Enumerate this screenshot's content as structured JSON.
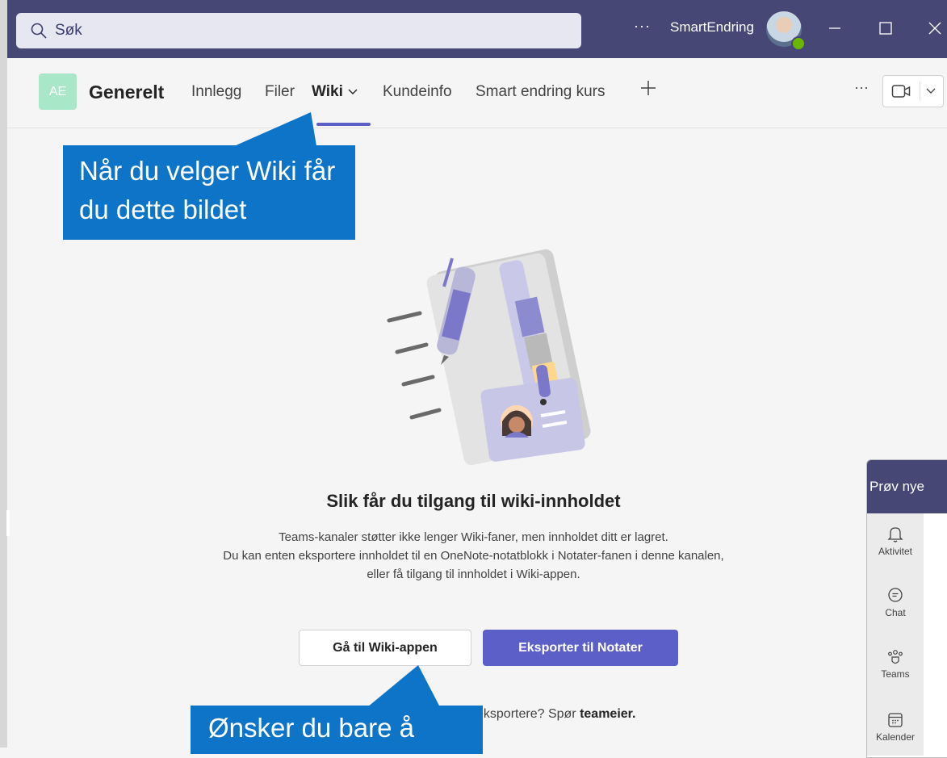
{
  "titlebar": {
    "search_placeholder": "Søk",
    "more": "···",
    "org_name": "SmartEndring"
  },
  "channel": {
    "team_initials": "AE",
    "name": "Generelt",
    "tabs": [
      {
        "label": "Innlegg"
      },
      {
        "label": "Filer"
      },
      {
        "label": "Wiki"
      },
      {
        "label": "Kundeinfo"
      },
      {
        "label": "Smart endring kurs"
      }
    ],
    "more": "···"
  },
  "callouts": {
    "wiki_hint": "Når du velger Wiki får du dette bildet",
    "export_hint": "Ønsker du bare å"
  },
  "main": {
    "heading": "Slik får du tilgang til wiki-innholdet",
    "body_lines": [
      "Teams-kanaler støtter ikke lenger Wiki-faner, men innholdet ditt er lagret.",
      "Du kan enten eksportere innholdet til en OneNote-notatblokk i Notater-fanen i denne kanalen,",
      "eller få tilgang til innholdet i Wiki-appen."
    ],
    "btn_wiki_app": "Gå til Wiki-appen",
    "btn_export": "Eksporter til Notater",
    "footer_prefix": "eksportere? Spør ",
    "footer_bold": "teameier."
  },
  "mini_panel": {
    "header": "Prøv nye",
    "rail": [
      {
        "label": "Aktivitet",
        "icon": "bell-icon"
      },
      {
        "label": "Chat",
        "icon": "chat-icon"
      },
      {
        "label": "Teams",
        "icon": "teams-icon"
      },
      {
        "label": "Kalender",
        "icon": "calendar-icon"
      }
    ]
  },
  "colors": {
    "titlebar": "#464775",
    "accent": "#5b5fc7",
    "callout": "#0e74c7",
    "team_avatar": "#a9e7c9"
  }
}
